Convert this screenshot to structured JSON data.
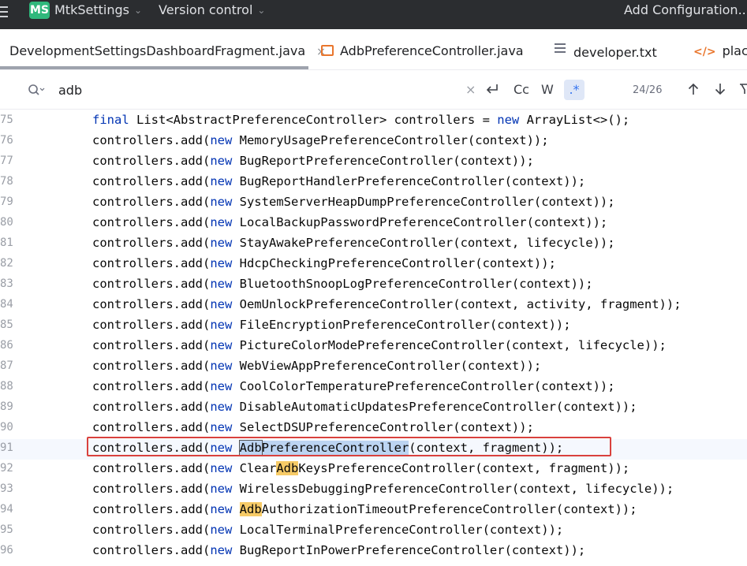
{
  "titlebar": {
    "project_badge": "MS",
    "project_name": "MtkSettings",
    "vcs_label": "Version control",
    "add_config_label": "Add Configuration..."
  },
  "tabs": [
    {
      "label": "DevelopmentSettingsDashboardFragment.java",
      "active": true,
      "close": "×"
    },
    {
      "label": "AdbPreferenceController.java",
      "active": false
    },
    {
      "label": "developer.txt",
      "active": false
    },
    {
      "label": "placel",
      "active": false
    }
  ],
  "search": {
    "query": "adb",
    "clear": "×",
    "opt_cc": "Cc",
    "opt_w": "W",
    "opt_regex": ".*",
    "counter": "24/26"
  },
  "editor": {
    "gutter": [
      "75",
      "76",
      "77",
      "78",
      "79",
      "80",
      "81",
      "82",
      "83",
      "84",
      "85",
      "86",
      "87",
      "88",
      "89",
      "90",
      "91",
      "92",
      "93",
      "94",
      "95",
      "96"
    ],
    "highlighted_line": "91",
    "lines": [
      {
        "pre": "",
        "kw": "final",
        "rest": " List<AbstractPreferenceController> controllers = ",
        "kw2": "new",
        "rest2": " ArrayList<>();"
      },
      {
        "pre": "controllers.add(",
        "kw": "new",
        "rest": " MemoryUsagePreferenceController(context));"
      },
      {
        "pre": "controllers.add(",
        "kw": "new",
        "rest": " BugReportPreferenceController(context));"
      },
      {
        "pre": "controllers.add(",
        "kw": "new",
        "rest": " BugReportHandlerPreferenceController(context));"
      },
      {
        "pre": "controllers.add(",
        "kw": "new",
        "rest": " SystemServerHeapDumpPreferenceController(context));"
      },
      {
        "pre": "controllers.add(",
        "kw": "new",
        "rest": " LocalBackupPasswordPreferenceController(context));"
      },
      {
        "pre": "controllers.add(",
        "kw": "new",
        "rest": " StayAwakePreferenceController(context, lifecycle));"
      },
      {
        "pre": "controllers.add(",
        "kw": "new",
        "rest": " HdcpCheckingPreferenceController(context));"
      },
      {
        "pre": "controllers.add(",
        "kw": "new",
        "rest": " BluetoothSnoopLogPreferenceController(context));"
      },
      {
        "pre": "controllers.add(",
        "kw": "new",
        "rest": " OemUnlockPreferenceController(context, activity, fragment));"
      },
      {
        "pre": "controllers.add(",
        "kw": "new",
        "rest": " FileEncryptionPreferenceController(context));"
      },
      {
        "pre": "controllers.add(",
        "kw": "new",
        "rest": " PictureColorModePreferenceController(context, lifecycle));"
      },
      {
        "pre": "controllers.add(",
        "kw": "new",
        "rest": " WebViewAppPreferenceController(context));"
      },
      {
        "pre": "controllers.add(",
        "kw": "new",
        "rest": " CoolColorTemperaturePreferenceController(context));"
      },
      {
        "pre": "controllers.add(",
        "kw": "new",
        "rest": " DisableAutomaticUpdatesPreferenceController(context));"
      },
      {
        "pre": "controllers.add(",
        "kw": "new",
        "rest": " SelectDSUPreferenceController(context));"
      },
      {
        "pre": "controllers.add(",
        "kw": "new",
        "sp": " ",
        "m1": "Adb",
        "m2": "PreferenceController",
        "rest": "(context, fragment));"
      },
      {
        "pre": "controllers.add(",
        "kw": "new",
        "sp": " ",
        "a": "Clear",
        "m": "Adb",
        "rest": "KeysPreferenceController(context, fragment));"
      },
      {
        "pre": "controllers.add(",
        "kw": "new",
        "rest": " WirelessDebuggingPreferenceController(context, lifecycle));"
      },
      {
        "pre": "controllers.add(",
        "kw": "new",
        "sp": " ",
        "a": "",
        "m": "Adb",
        "rest": "AuthorizationTimeoutPreferenceController(context));"
      },
      {
        "pre": "controllers.add(",
        "kw": "new",
        "rest": " LocalTerminalPreferenceController(context));"
      },
      {
        "pre": "controllers.add(",
        "kw": "new",
        "rest": " BugReportInPowerPreferenceController(context));"
      }
    ]
  },
  "colors": {
    "keyword": "#0033b3",
    "match_highlight": "#f7cb67",
    "current_match": "#bcd4f2",
    "annotation_frame": "#d9413d",
    "project_badge": "#2fb87c"
  }
}
